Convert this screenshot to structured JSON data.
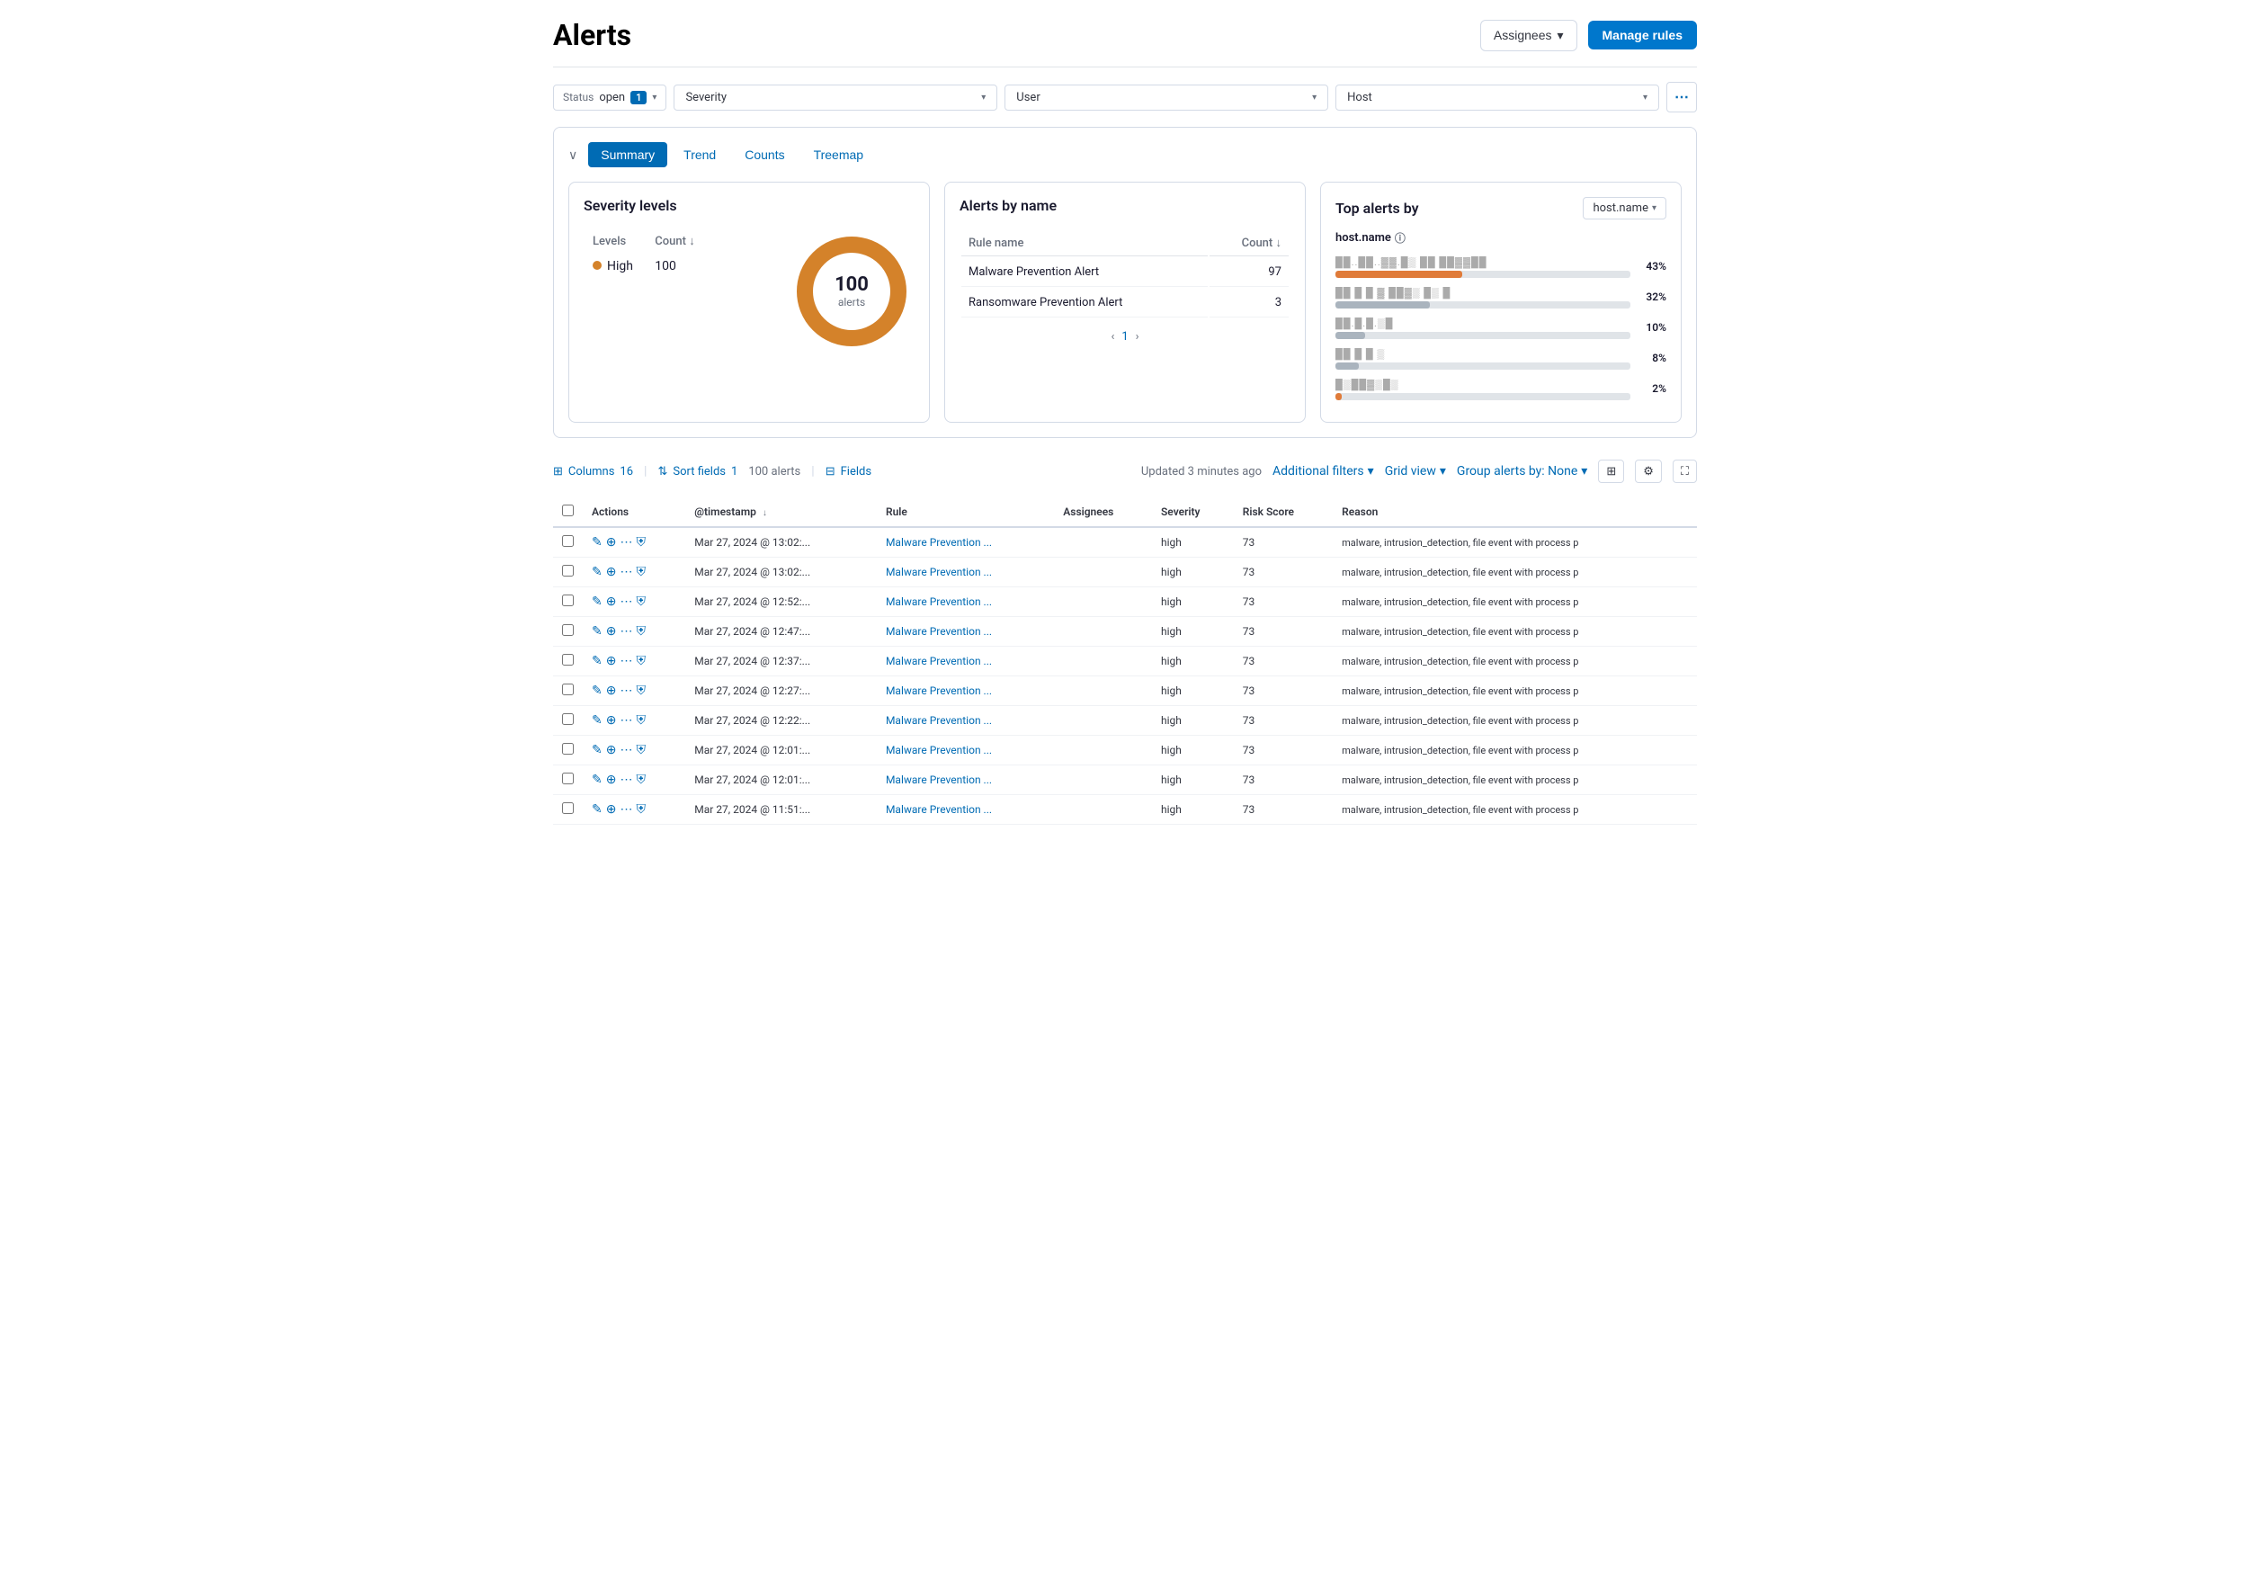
{
  "page": {
    "title": "Alerts"
  },
  "header": {
    "assignees_label": "Assignees",
    "manage_rules_label": "Manage rules"
  },
  "filters": {
    "status_label": "Status",
    "status_value": "open",
    "badge_count": "1",
    "severity_label": "Severity",
    "user_label": "User",
    "host_label": "Host",
    "more_icon": "⋯"
  },
  "viz_panel": {
    "collapse_icon": "∨",
    "tabs": [
      {
        "label": "Summary",
        "active": true
      },
      {
        "label": "Trend",
        "active": false
      },
      {
        "label": "Counts",
        "active": false
      },
      {
        "label": "Treemap",
        "active": false
      }
    ]
  },
  "severity_card": {
    "title": "Severity levels",
    "levels_col": "Levels",
    "count_col": "Count",
    "rows": [
      {
        "level": "High",
        "count": "100",
        "color": "#D4822A"
      }
    ],
    "donut": {
      "total": "100",
      "label": "alerts",
      "segments": [
        {
          "color": "#D4822A",
          "pct": 100
        }
      ]
    }
  },
  "alerts_name_card": {
    "title": "Alerts by name",
    "rule_col": "Rule name",
    "count_col": "Count",
    "rows": [
      {
        "name": "Malware Prevention Alert",
        "count": "97"
      },
      {
        "name": "Ransomware Prevention Alert",
        "count": "3"
      }
    ],
    "pagination": {
      "prev": "‹",
      "current": "1",
      "next": "›"
    }
  },
  "top_alerts_card": {
    "title": "Top alerts by",
    "dropdown_label": "host.name",
    "host_label": "host.name",
    "bars": [
      {
        "name": "██..██..▓▓.█▒ ██ ██▓▓██",
        "pct": 43,
        "pct_label": "43%",
        "color": "#E07B39"
      },
      {
        "name": "██ █ █ ▓ ██▓▒ █▒ █",
        "pct": 32,
        "pct_label": "32%",
        "color": "#aab4be"
      },
      {
        "name": "██.█.█.▒█",
        "pct": 10,
        "pct_label": "10%",
        "color": "#aab4be"
      },
      {
        "name": "██ █ █ ▒",
        "pct": 8,
        "pct_label": "8%",
        "color": "#aab4be"
      },
      {
        "name": "█▒██▓▒█▒",
        "pct": 2,
        "pct_label": "2%",
        "color": "#E07B39"
      }
    ]
  },
  "toolbar": {
    "columns_label": "Columns",
    "columns_count": "16",
    "sort_label": "Sort fields",
    "sort_count": "1",
    "alerts_count": "100 alerts",
    "fields_label": "Fields",
    "updated_label": "Updated 3 minutes ago",
    "additional_filters_label": "Additional filters",
    "grid_view_label": "Grid view",
    "group_alerts_label": "Group alerts by: None"
  },
  "table": {
    "columns": [
      "Actions",
      "@timestamp",
      "Rule",
      "Assignees",
      "Severity",
      "Risk Score",
      "Reason"
    ],
    "rows": [
      {
        "timestamp": "Mar 27, 2024 @ 13:02:...",
        "rule": "Malware Prevention ...",
        "assignees": "",
        "severity": "high",
        "risk_score": "73",
        "reason": "malware, intrusion_detection, file event with process p"
      },
      {
        "timestamp": "Mar 27, 2024 @ 13:02:...",
        "rule": "Malware Prevention ...",
        "assignees": "",
        "severity": "high",
        "risk_score": "73",
        "reason": "malware, intrusion_detection, file event with process p"
      },
      {
        "timestamp": "Mar 27, 2024 @ 12:52:...",
        "rule": "Malware Prevention ...",
        "assignees": "",
        "severity": "high",
        "risk_score": "73",
        "reason": "malware, intrusion_detection, file event with process p"
      },
      {
        "timestamp": "Mar 27, 2024 @ 12:47:...",
        "rule": "Malware Prevention ...",
        "assignees": "",
        "severity": "high",
        "risk_score": "73",
        "reason": "malware, intrusion_detection, file event with process p"
      },
      {
        "timestamp": "Mar 27, 2024 @ 12:37:...",
        "rule": "Malware Prevention ...",
        "assignees": "",
        "severity": "high",
        "risk_score": "73",
        "reason": "malware, intrusion_detection, file event with process p"
      },
      {
        "timestamp": "Mar 27, 2024 @ 12:27:...",
        "rule": "Malware Prevention ...",
        "assignees": "",
        "severity": "high",
        "risk_score": "73",
        "reason": "malware, intrusion_detection, file event with process p"
      },
      {
        "timestamp": "Mar 27, 2024 @ 12:22:...",
        "rule": "Malware Prevention ...",
        "assignees": "",
        "severity": "high",
        "risk_score": "73",
        "reason": "malware, intrusion_detection, file event with process p"
      },
      {
        "timestamp": "Mar 27, 2024 @ 12:01:...",
        "rule": "Malware Prevention ...",
        "assignees": "",
        "severity": "high",
        "risk_score": "73",
        "reason": "malware, intrusion_detection, file event with process p"
      },
      {
        "timestamp": "Mar 27, 2024 @ 12:01:...",
        "rule": "Malware Prevention ...",
        "assignees": "",
        "severity": "high",
        "risk_score": "73",
        "reason": "malware, intrusion_detection, file event with process p"
      },
      {
        "timestamp": "Mar 27, 2024 @ 11:51:...",
        "rule": "Malware Prevention ...",
        "assignees": "",
        "severity": "high",
        "risk_score": "73",
        "reason": "malware, intrusion_detection, file event with process p"
      }
    ]
  }
}
